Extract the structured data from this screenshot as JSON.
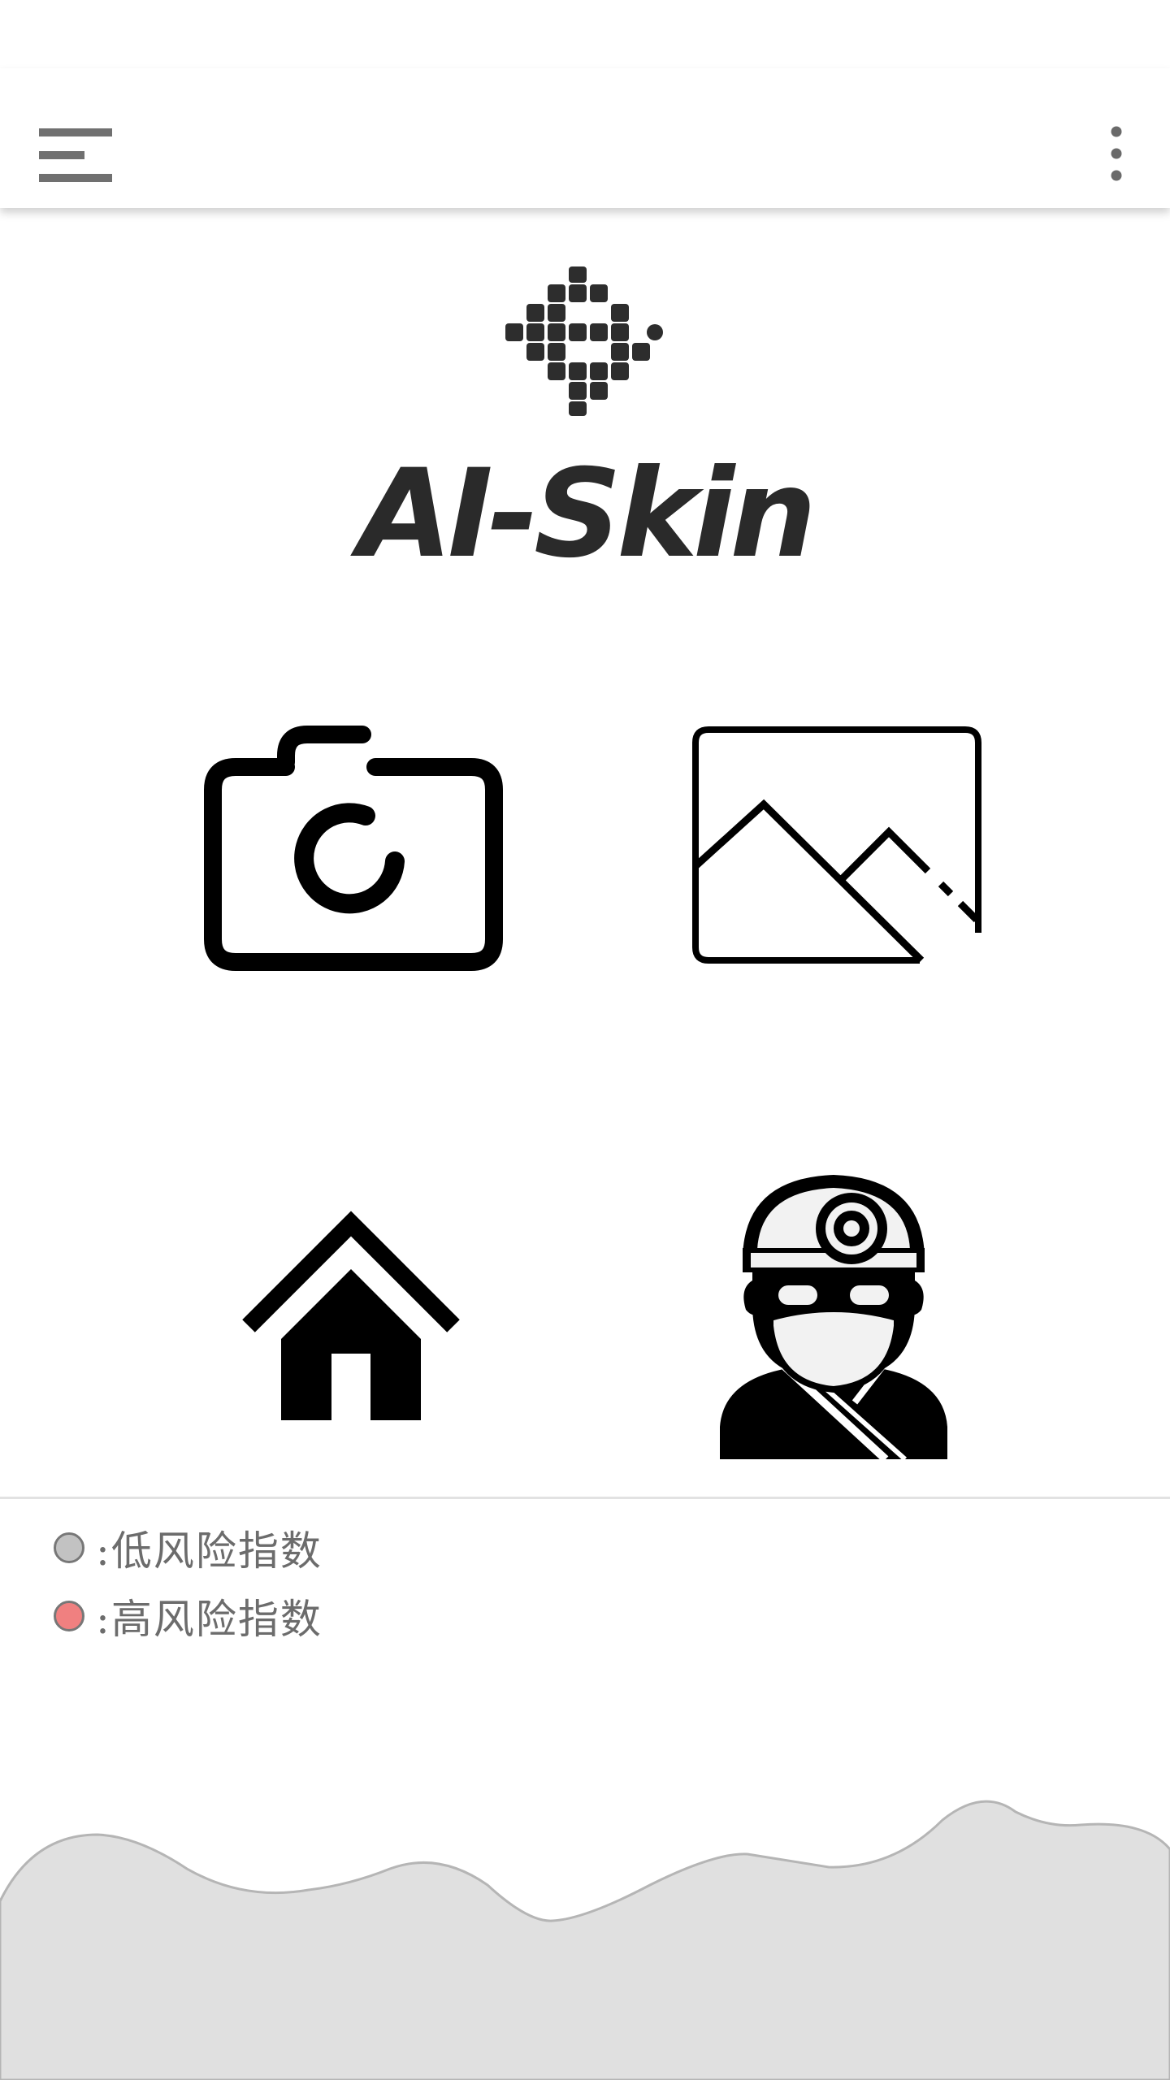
{
  "app": {
    "title": "AI-Skin"
  },
  "toolbar": {
    "menu_icon": "hamburger-menu-icon",
    "more_icon": "more-vertical-icon"
  },
  "actions": [
    {
      "id": "camera",
      "icon": "camera-icon"
    },
    {
      "id": "gallery",
      "icon": "image-gallery-icon"
    },
    {
      "id": "home",
      "icon": "home-icon"
    },
    {
      "id": "doctor",
      "icon": "doctor-icon"
    }
  ],
  "legend": {
    "low": {
      "color": "#c2c2c2",
      "label": ":低风险指数"
    },
    "high": {
      "color": "#f08080",
      "label": ":高风险指数"
    }
  },
  "colors": {
    "icon": "#000000",
    "wave_fill": "#e0e0e0",
    "wave_stroke": "#b5b5b5"
  }
}
